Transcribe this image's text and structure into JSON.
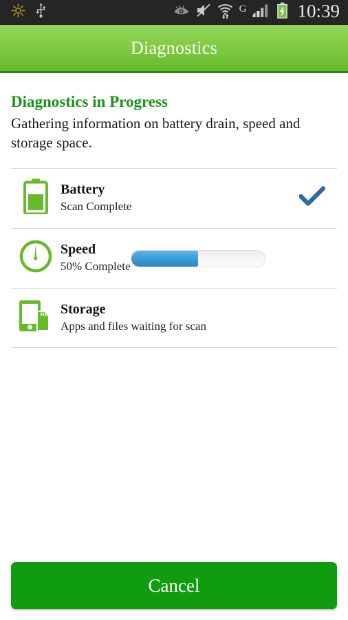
{
  "status_bar": {
    "time": "10:39",
    "network_label": "G",
    "left_icons": [
      {
        "name": "brightness-sun-icon",
        "color": "#b5941e"
      },
      {
        "name": "usb-icon",
        "color": "#c9c9c9"
      }
    ],
    "right_icons": [
      {
        "name": "eye-care-icon",
        "color": "#9a9a9a"
      },
      {
        "name": "sound-muted-icon",
        "color": "#c9c9c9"
      },
      {
        "name": "wifi-transfer-icon",
        "color": "#d0d0d0"
      },
      {
        "name": "cellular-signal-icon",
        "color": "#c9c9c9"
      },
      {
        "name": "battery-charging-icon",
        "color": "#7ac143"
      }
    ]
  },
  "header": {
    "title": "Diagnostics",
    "gradient_top": "#93d45a",
    "gradient_bottom": "#63bb2a",
    "border_color": "#1f8a0b"
  },
  "content": {
    "heading": "Diagnostics in Progress",
    "heading_color": "#199218",
    "description": "Gathering information on battery drain, speed and storage space."
  },
  "scan_items": [
    {
      "id": "battery",
      "icon": "battery-icon",
      "title": "Battery",
      "status": "Scan Complete",
      "state": "complete",
      "check_color": "#2e6da4"
    },
    {
      "id": "speed",
      "icon": "speedometer-icon",
      "title": "Speed",
      "status": "50% Complete",
      "state": "in-progress",
      "progress_percent": 50,
      "progress_color": "#3e9ed6"
    },
    {
      "id": "storage",
      "icon": "storage-phone-sdcard-icon",
      "title": "Storage",
      "status": "Apps and files waiting for scan",
      "state": "pending"
    }
  ],
  "footer": {
    "cancel_label": "Cancel",
    "cancel_color": "#0f9c0f"
  }
}
